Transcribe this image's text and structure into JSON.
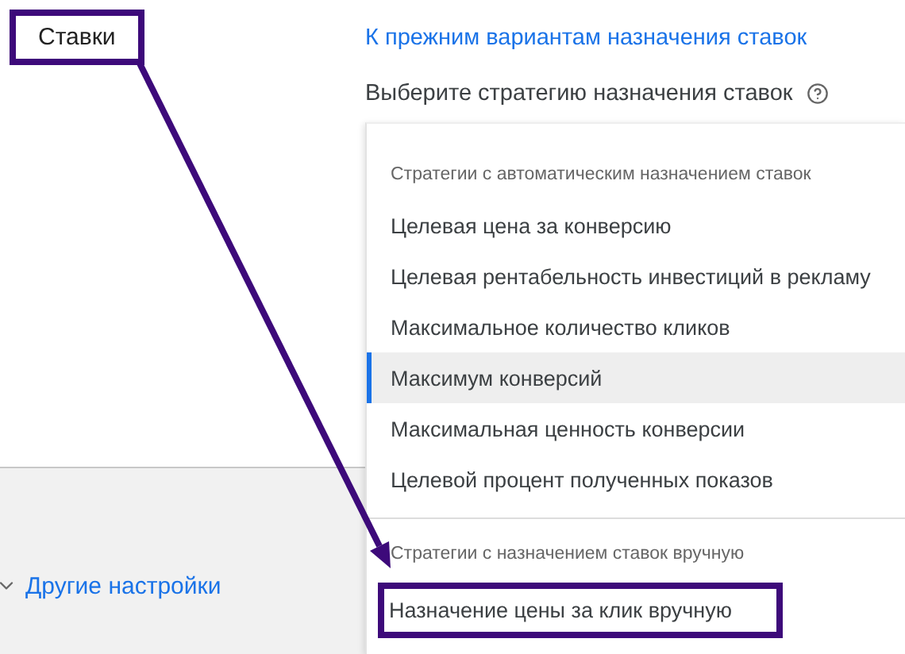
{
  "section": {
    "label": "Ставки",
    "highlighted": true
  },
  "back_link": "К прежним вариантам назначения ставок",
  "strategy_prompt": "Выберите стратегию назначения ставок",
  "other_settings": "Другие настройки",
  "menu": {
    "groups": [
      {
        "heading": "Стратегии с автоматическим назначением ставок",
        "items": [
          {
            "label": "Целевая цена за конверсию",
            "selected": false,
            "highlighted": false
          },
          {
            "label": "Целевая рентабельность инвестиций в рекламу",
            "selected": false,
            "highlighted": false
          },
          {
            "label": "Максимальное количество кликов",
            "selected": false,
            "highlighted": false
          },
          {
            "label": "Максимум конверсий",
            "selected": true,
            "highlighted": false
          },
          {
            "label": "Максимальная ценность конверсии",
            "selected": false,
            "highlighted": false
          },
          {
            "label": "Целевой процент полученных показов",
            "selected": false,
            "highlighted": false
          }
        ]
      },
      {
        "heading": "Стратегии с назначением ставок вручную",
        "items": [
          {
            "label": "Назначение цены за клик вручную",
            "selected": false,
            "highlighted": true
          }
        ]
      }
    ]
  }
}
